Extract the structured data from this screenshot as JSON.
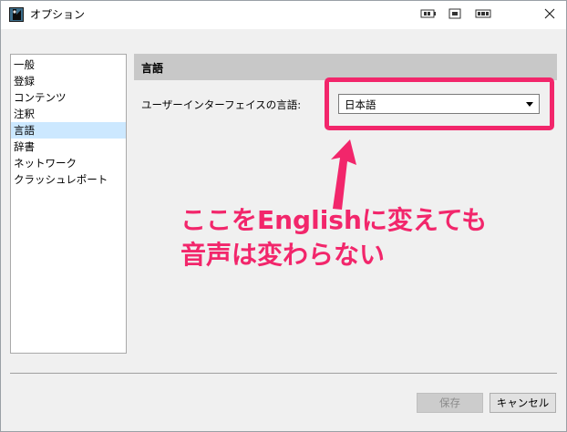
{
  "window": {
    "title": "オプション"
  },
  "sidebar": {
    "items": [
      {
        "label": "一般"
      },
      {
        "label": "登録"
      },
      {
        "label": "コンテンツ"
      },
      {
        "label": "注釈"
      },
      {
        "label": "言語"
      },
      {
        "label": "辞書"
      },
      {
        "label": "ネットワーク"
      },
      {
        "label": "クラッシュレポート"
      }
    ],
    "selected_label": "言語"
  },
  "main": {
    "section_title": "言語",
    "language_label": "ユーザーインターフェイスの言語:",
    "language_value": "日本語"
  },
  "annotation": {
    "line1": "ここをEnglishに変えても",
    "line2": "音声は変わらない",
    "color": "#f2266b"
  },
  "footer": {
    "save_label": "保存",
    "cancel_label": "キャンセル"
  },
  "colors": {
    "selected_item": "#cce8ff",
    "section_header": "#c8c8c8"
  }
}
